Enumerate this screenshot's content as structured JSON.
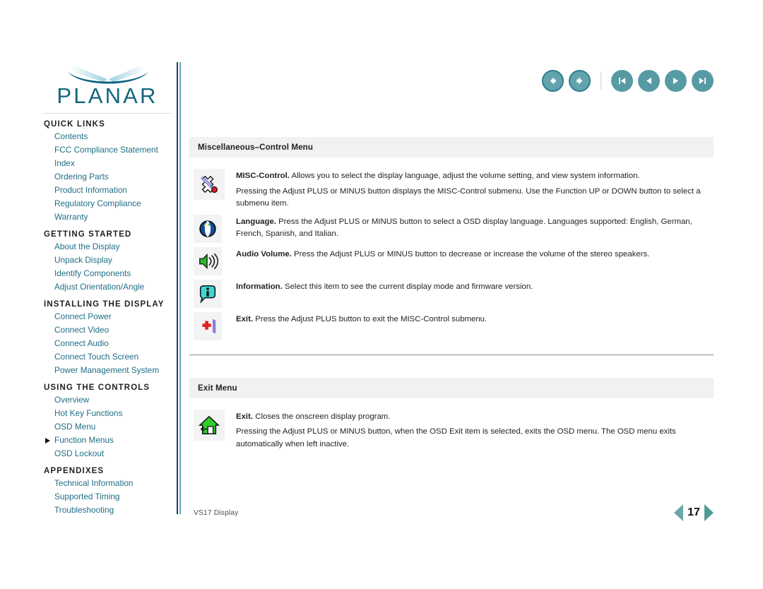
{
  "brand": {
    "name": "PLANAR",
    "logo_icon": "planar-swoosh-logo"
  },
  "topnav": {
    "buttons": [
      {
        "name": "back-button",
        "icon": "arrow-left-icon",
        "style": "outline"
      },
      {
        "name": "forward-button",
        "icon": "arrow-right-icon",
        "style": "outline"
      },
      {
        "name": "first-page-button",
        "icon": "skip-to-start-icon",
        "style": "solid"
      },
      {
        "name": "previous-page-button",
        "icon": "triangle-left-icon",
        "style": "solid"
      },
      {
        "name": "next-page-button",
        "icon": "triangle-right-icon",
        "style": "solid"
      },
      {
        "name": "last-page-button",
        "icon": "skip-to-end-icon",
        "style": "solid"
      }
    ],
    "accent_outline_fill": "#63a3ae",
    "accent_outline_border": "#2b7f90",
    "accent_solid": "#569aa3"
  },
  "sidebar": {
    "groups": [
      {
        "heading": "QUICK LINKS",
        "items": [
          {
            "label": "Contents",
            "current": false
          },
          {
            "label": "FCC Compliance Statement",
            "current": false
          },
          {
            "label": "Index",
            "current": false
          },
          {
            "label": "Ordering Parts",
            "current": false
          },
          {
            "label": "Product Information",
            "current": false
          },
          {
            "label": "Regulatory Compliance",
            "current": false
          },
          {
            "label": "Warranty",
            "current": false
          }
        ]
      },
      {
        "heading": "GETTING STARTED",
        "items": [
          {
            "label": "About the Display",
            "current": false
          },
          {
            "label": "Unpack Display",
            "current": false
          },
          {
            "label": "Identify Components",
            "current": false
          },
          {
            "label": "Adjust Orientation/Angle",
            "current": false
          }
        ]
      },
      {
        "heading": "INSTALLING THE DISPLAY",
        "items": [
          {
            "label": "Connect Power",
            "current": false
          },
          {
            "label": "Connect Video",
            "current": false
          },
          {
            "label": "Connect Audio",
            "current": false
          },
          {
            "label": "Connect Touch Screen",
            "current": false
          },
          {
            "label": "Power Management System",
            "current": false
          }
        ]
      },
      {
        "heading": "USING THE CONTROLS",
        "items": [
          {
            "label": "Overview",
            "current": false
          },
          {
            "label": "Hot Key Functions",
            "current": false
          },
          {
            "label": "OSD Menu",
            "current": false
          },
          {
            "label": "Function Menus",
            "current": true
          },
          {
            "label": "OSD Lockout",
            "current": false
          }
        ]
      },
      {
        "heading": "APPENDIXES",
        "items": [
          {
            "label": "Technical Information",
            "current": false
          },
          {
            "label": "Supported Timing",
            "current": false
          },
          {
            "label": "Troubleshooting",
            "current": false
          }
        ]
      }
    ],
    "link_color": "#1f6e86"
  },
  "main": {
    "sections": [
      {
        "title": "Miscellaneous–Control Menu",
        "entries": [
          {
            "icon": "wrench-tools-icon",
            "paragraphs": [
              {
                "lead": "MISC-Control.",
                "text": " Allows you to select the display language, adjust the volume setting, and view system information."
              },
              {
                "lead": "",
                "text": "Pressing the Adjust PLUS or MINUS button displays the MISC-Control submenu. Use the Function UP or DOWN button to select a submenu item."
              }
            ]
          },
          {
            "icon": "globe-language-icon",
            "paragraphs": [
              {
                "lead": "Language.",
                "text": " Press the Adjust PLUS or MINUS button to select a OSD display language. Languages supported: English, German, French, Spanish, and Italian."
              }
            ]
          },
          {
            "icon": "speaker-volume-icon",
            "paragraphs": [
              {
                "lead": "Audio Volume.",
                "text": " Press the Adjust PLUS or MINUS button to decrease or increase the volume of the stereo speakers."
              }
            ]
          },
          {
            "icon": "information-bubble-icon",
            "paragraphs": [
              {
                "lead": "Information.",
                "text": " Select this item to see the current display mode and firmware version."
              }
            ]
          },
          {
            "icon": "exit-door-icon",
            "paragraphs": [
              {
                "lead": "Exit.",
                "text": " Press the Adjust PLUS button to exit the MISC-Control submenu."
              }
            ]
          }
        ]
      },
      {
        "title": "Exit Menu",
        "entries": [
          {
            "icon": "green-house-exit-icon",
            "paragraphs": [
              {
                "lead": "Exit.",
                "text": " Closes the onscreen display program."
              },
              {
                "lead": "",
                "text": "Pressing the Adjust PLUS or MINUS button, when the OSD Exit item is selected, exits the OSD menu. The OSD menu exits automatically when left inactive."
              }
            ]
          }
        ]
      }
    ]
  },
  "footer": {
    "document_label": "VS17 Display",
    "page_number": "17",
    "prev_icon": "triangle-left-icon",
    "next_icon": "triangle-right-icon"
  }
}
